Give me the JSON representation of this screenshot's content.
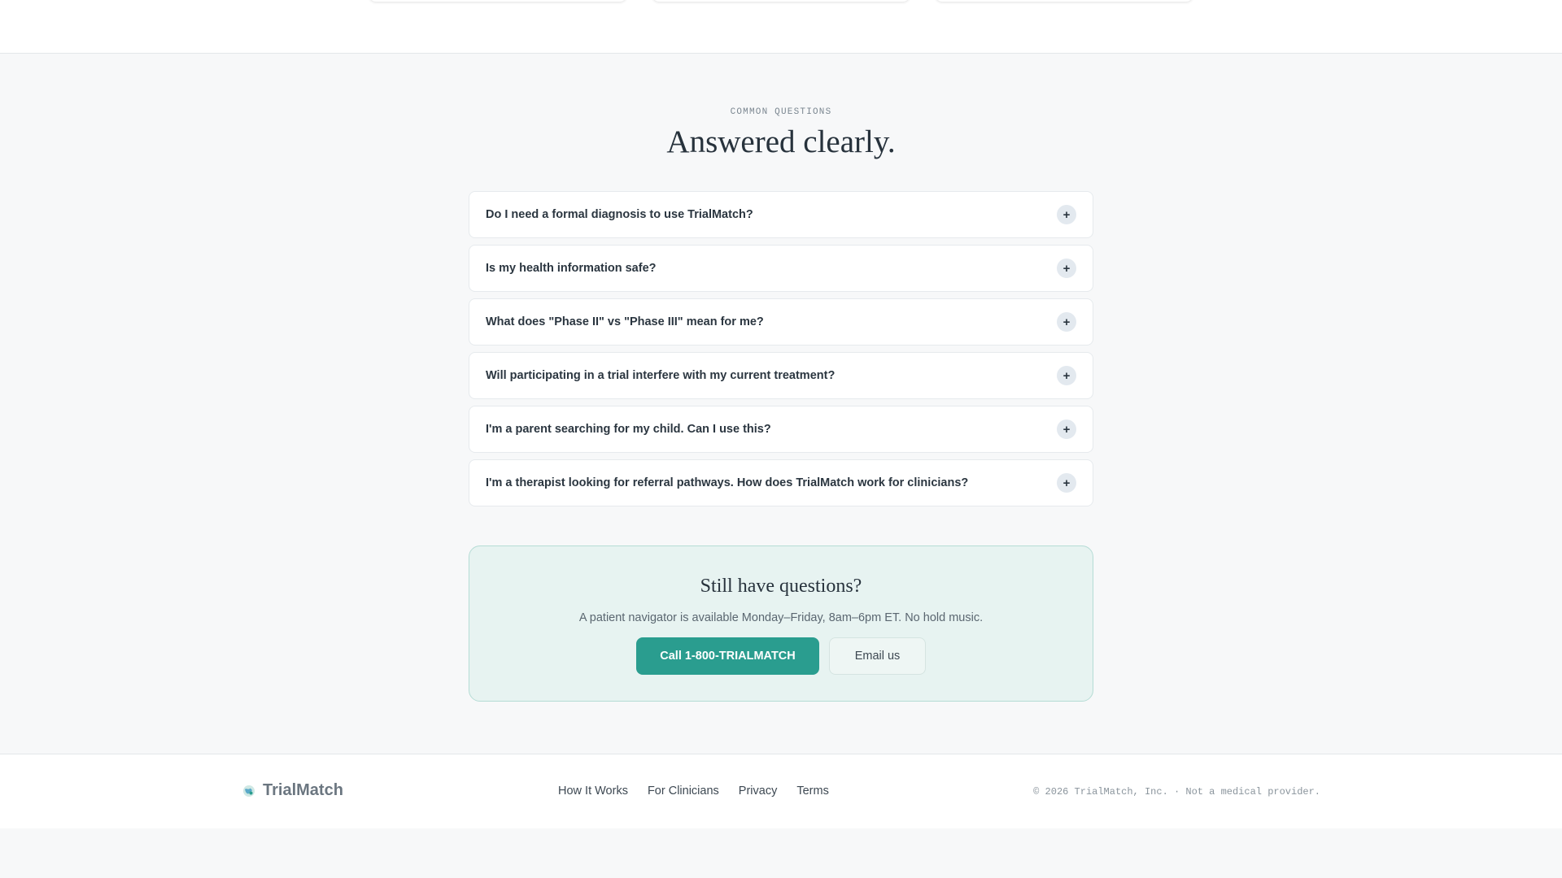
{
  "faq": {
    "eyebrow": "COMMON QUESTIONS",
    "title": "Answered clearly.",
    "toggle_icon": "plus-icon",
    "items": [
      {
        "question": "Do I need a formal diagnosis to use TrialMatch?"
      },
      {
        "question": "Is my health information safe?"
      },
      {
        "question": "What does \"Phase II\" vs \"Phase III\" mean for me?"
      },
      {
        "question": "Will participating in a trial interfere with my current treatment?"
      },
      {
        "question": "I'm a parent searching for my child. Can I use this?"
      },
      {
        "question": "I'm a therapist looking for referral pathways. How does TrialMatch work for clinicians?"
      }
    ]
  },
  "cta": {
    "title": "Still have questions?",
    "subtitle": "A patient navigator is available Monday–Friday, 8am–6pm ET. No hold music.",
    "call_label": "Call 1-800-TRIALMATCH",
    "email_label": "Email us"
  },
  "footer": {
    "brand": "TrialMatch",
    "logo_icon": "globe-logo-icon",
    "links": [
      "How It Works",
      "For Clinicians",
      "Privacy",
      "Terms"
    ],
    "copyright": "© 2026 TrialMatch, Inc. · Not a medical provider."
  },
  "colors": {
    "accent": "#2a9d8f",
    "cta_background": "#e7f3f1",
    "page_background": "#f7f8f9"
  }
}
